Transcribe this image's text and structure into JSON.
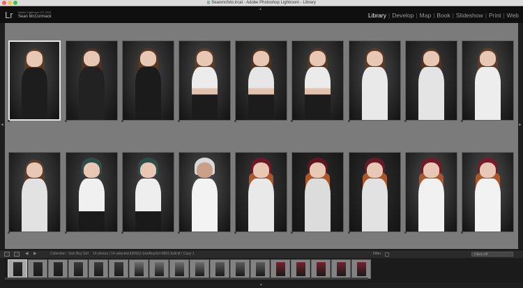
{
  "window": {
    "title": "Seanmcfoto.lrcat - Adobe Photoshop Lightroom - Library"
  },
  "identity": {
    "logo": "Lr",
    "version": "Adobe Lightroom CC 2015",
    "user": "Sean McCormack"
  },
  "modules": [
    {
      "label": "Library",
      "active": true
    },
    {
      "label": "Develop",
      "active": false
    },
    {
      "label": "Map",
      "active": false
    },
    {
      "label": "Book",
      "active": false
    },
    {
      "label": "Slideshow",
      "active": false
    },
    {
      "label": "Print",
      "active": false
    },
    {
      "label": "Web",
      "active": false
    }
  ],
  "grid": {
    "rows": [
      [
        {
          "selected": true,
          "bg": "#4a4a4a",
          "hair": "#5a3a28",
          "top": "#1d1d1d",
          "style": "dark-dress"
        },
        {
          "selected": false,
          "bg": "#3e3e3e",
          "hair": "#4e3324",
          "top": "#222",
          "style": "dark-dress"
        },
        {
          "selected": false,
          "bg": "#474747",
          "hair": "#553725",
          "top": "#1b1b1b",
          "style": "dark-dress"
        },
        {
          "selected": false,
          "bg": "#4b4b4b",
          "hair": "#5b3c29",
          "top": "#ececec",
          "style": "white-top"
        },
        {
          "selected": false,
          "bg": "#3f3f3f",
          "hair": "#4f3424",
          "top": "#e6e6e6",
          "style": "white-top"
        },
        {
          "selected": false,
          "bg": "#454545",
          "hair": "#573826",
          "top": "#ebebeb",
          "style": "white-top"
        },
        {
          "selected": false,
          "bg": "#4c4c4c",
          "hair": "#5a3b28",
          "top": "#e9e9e9",
          "style": "white-sweater"
        },
        {
          "selected": false,
          "bg": "#3d3d3d",
          "hair": "#4f3425",
          "top": "#e4e4e4",
          "style": "white-sweater"
        },
        {
          "selected": false,
          "bg": "#4a4a4a",
          "hair": "#5c3d2a",
          "top": "#ededed",
          "style": "white-sweater"
        }
      ],
      [
        {
          "selected": false,
          "bg": "#4a4a4a",
          "hair": "#5b3c29",
          "top": "#e2e2e2",
          "style": "white-sweater"
        },
        {
          "selected": false,
          "bg": "#444444",
          "hair": "#2e4c48",
          "top": "#f0f0f0",
          "style": "cap-tee"
        },
        {
          "selected": false,
          "bg": "#484848",
          "hair": "#2e4c48",
          "top": "#eeeeee",
          "style": "cap-tee"
        },
        {
          "selected": false,
          "bg": "#525252",
          "hair": "#d9d9d9",
          "top": "#f3f3f3",
          "style": "cap-back"
        },
        {
          "selected": false,
          "bg": "#3c3c3c",
          "hair": "#6a1a26",
          "top": "#e9e9e9",
          "style": "beanie"
        },
        {
          "selected": false,
          "bg": "#2a2a2a",
          "hair": "#5c1620",
          "top": "#dcdcdc",
          "style": "beanie"
        },
        {
          "selected": false,
          "bg": "#2f2f2f",
          "hair": "#661a25",
          "top": "#e2e2e2",
          "style": "beanie"
        },
        {
          "selected": false,
          "bg": "#505050",
          "hair": "#6e1c28",
          "top": "#f1f1f1",
          "style": "beanie"
        },
        {
          "selected": false,
          "bg": "#545454",
          "hair": "#721d2a",
          "top": "#f2f2f2",
          "style": "beanie"
        }
      ]
    ]
  },
  "toolbar": {
    "collection_label": "Collection : Sick Boy Girl",
    "photo_count": "14 photos / 14 selected /",
    "filename": "100912-SickBoyGirl-8902-Edit.tif / Copy 1",
    "filter_label": "Filter :",
    "filters_value": "Filters Off"
  },
  "filmstrip": {
    "count": 18,
    "selected_index": 0,
    "colors": [
      "#2b2b2b",
      "#2b2b2b",
      "#2b2b2b",
      "#3a3a3a",
      "#3a3a3a",
      "#3a3a3a",
      "#6d6d6d",
      "#6d6d6d",
      "#6d6d6d",
      "#6d6d6d",
      "#5a5a5a",
      "#5a5a5a",
      "#5a5a5a",
      "#6f2230",
      "#6f2230",
      "#6f2230",
      "#6f2230",
      "#6f2230"
    ]
  },
  "colors": {
    "accent": "#f2f2f2",
    "grid_bg": "#7b7b7b",
    "chrome": "#0f0f0f"
  }
}
